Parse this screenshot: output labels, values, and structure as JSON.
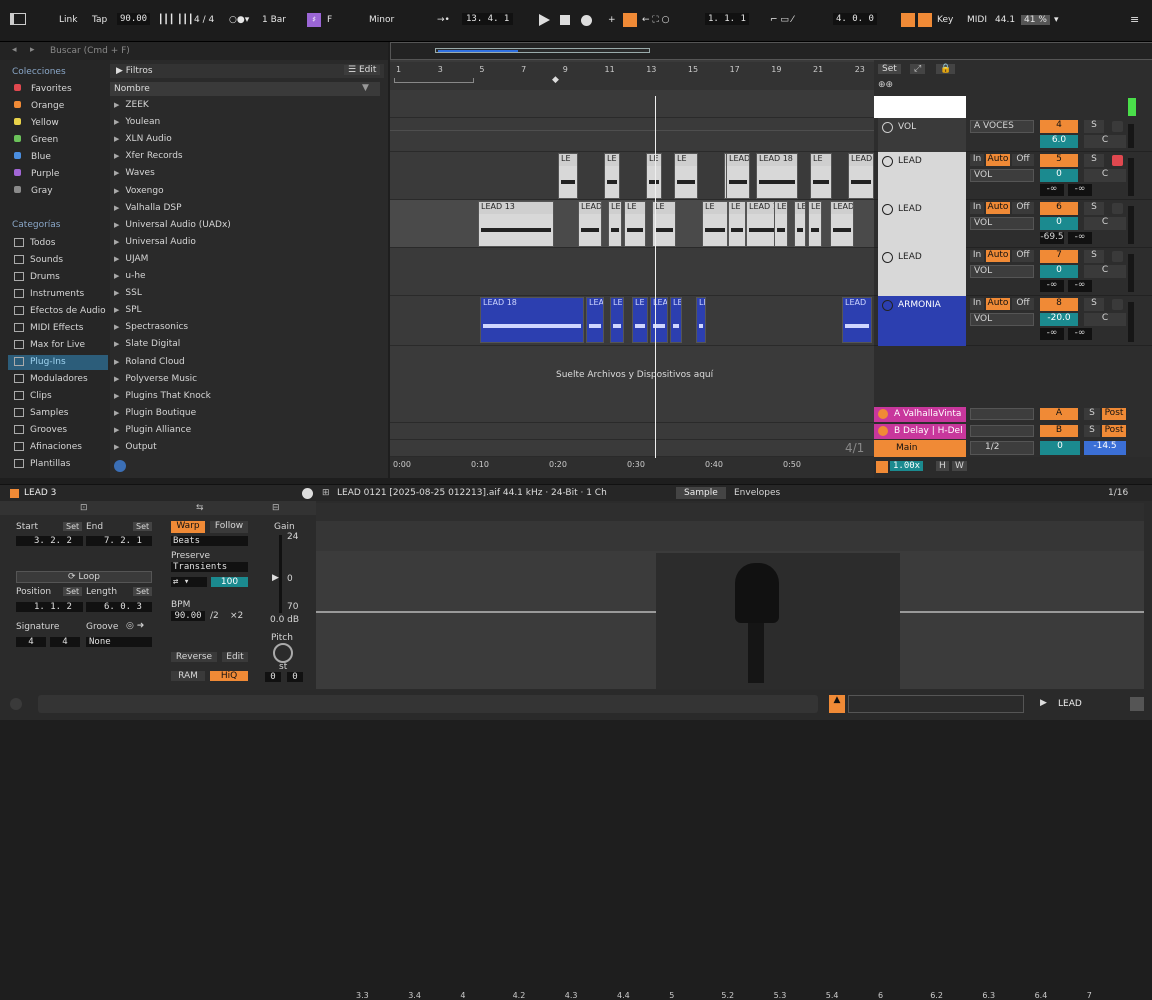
{
  "transport": {
    "link": "Link",
    "tap": "Tap",
    "tempo": "90.00",
    "meter": "4 / 4",
    "quantize": "1 Bar",
    "key_root": "F",
    "scale": "Minor",
    "position": "13.   4.   1",
    "loop_start": "1.   1.   1",
    "loop_length": "4.   0.   0",
    "key_btn": "Key",
    "midi_btn": "MIDI",
    "sample_rate": "44.1",
    "cpu": "41 %"
  },
  "browser": {
    "search_placeholder": "Buscar (Cmd + F)",
    "colecciones_title": "Colecciones",
    "colecciones": [
      {
        "label": "Favorites",
        "color": "#e0484f"
      },
      {
        "label": "Orange",
        "color": "#f08a36"
      },
      {
        "label": "Yellow",
        "color": "#e8d24a"
      },
      {
        "label": "Green",
        "color": "#6bc25a"
      },
      {
        "label": "Blue",
        "color": "#4a8ee0"
      },
      {
        "label": "Purple",
        "color": "#a266d6"
      },
      {
        "label": "Gray",
        "color": "#8a8a8a"
      }
    ],
    "categorias_title": "Categorías",
    "categorias": [
      "Todos",
      "Sounds",
      "Drums",
      "Instruments",
      "Efectos de Audio",
      "MIDI Effects",
      "Max for Live",
      "Plug-Ins",
      "Moduladores",
      "Clips",
      "Samples",
      "Grooves",
      "Afinaciones",
      "Plantillas"
    ],
    "filtros": "Filtros",
    "edit": "Edit",
    "nombre": "Nombre",
    "folders": [
      "ZEEK",
      "Youlean",
      "XLN Audio",
      "Xfer Records",
      "Waves",
      "Voxengo",
      "Valhalla DSP",
      "Universal Audio (UADx)",
      "Universal Audio",
      "UJAM",
      "u-he",
      "SSL",
      "SPL",
      "Spectrasonics",
      "Slate Digital",
      "Roland Cloud",
      "Polyverse Music",
      "Plugins That Knock",
      "Plugin Boutique",
      "Plugin Alliance",
      "Output"
    ]
  },
  "arrangement": {
    "ruler": [
      "1",
      "3",
      "5",
      "7",
      "9",
      "11",
      "13",
      "15",
      "17",
      "19",
      "21",
      "23"
    ],
    "set_btn": "Set",
    "drop_hint": "Suelte Archivos y Dispositivos aquí",
    "time_ruler": [
      "0:00",
      "0:10",
      "0:20",
      "0:30",
      "0:40",
      "0:50"
    ],
    "time_sig": "4/1",
    "clips_lead1": [
      "LE",
      "LE",
      "LE",
      "LE",
      "LEAD",
      "LEAD",
      "LEAD 18",
      "LE",
      "LEAD"
    ],
    "clips_lead2": [
      "LEAD 13",
      "LEAD",
      "LE",
      "LE",
      "LE",
      "LE",
      "LE",
      "LEAD 1",
      "LE",
      "LE",
      "LE",
      "LEAD"
    ],
    "clips_armonia": [
      "LEAD 18",
      "LEA",
      "LE",
      "LE",
      "LEAI",
      "LE",
      "LE",
      "LEAD"
    ]
  },
  "mixer": {
    "tracks": [
      {
        "name": "VOL",
        "routing": "A VOCES",
        "num": "4",
        "vol": "6.0",
        "pan": "C"
      },
      {
        "name": "LEAD",
        "routing": "VOL",
        "num": "5",
        "vol": "0",
        "pan": "C",
        "send1": "-∞",
        "send2": "-∞"
      },
      {
        "name": "LEAD",
        "routing": "VOL",
        "num": "6",
        "vol": "0",
        "pan": "C",
        "send1": "-69.5",
        "send2": "-∞"
      },
      {
        "name": "LEAD",
        "routing": "VOL",
        "num": "7",
        "vol": "0",
        "pan": "C",
        "send1": "-∞",
        "send2": "-∞"
      },
      {
        "name": "ARMONIA",
        "routing": "VOL",
        "num": "8",
        "vol": "-20.0",
        "pan": "C",
        "send1": "-∞",
        "send2": "-∞"
      }
    ],
    "returns": [
      {
        "name": "A ValhallaVinta",
        "letter": "A",
        "post": "Post"
      },
      {
        "name": "B Delay | H-Del",
        "letter": "B",
        "post": "Post"
      }
    ],
    "main": {
      "name": "Main",
      "routing": "1/2",
      "num": "0",
      "vol": "-14.5"
    },
    "in": "In",
    "auto": "Auto",
    "off": "Off",
    "s": "S",
    "c": "C",
    "zoom": "1.00x",
    "h": "H",
    "w": "W"
  },
  "clipview": {
    "title": "LEAD 3",
    "start_label": "Start",
    "end_label": "End",
    "set": "Set",
    "start_val": "3.   2.   2",
    "end_val": "7.   2.   1",
    "loop": "Loop",
    "position_label": "Position",
    "length_label": "Length",
    "position_val": "1.   1.   2",
    "length_val": "6.   0.   3",
    "signature_label": "Signature",
    "groove_label": "Groove",
    "sig_num": "4",
    "sig_den": "4",
    "groove_val": "None",
    "warp": "Warp",
    "follow": "Follow",
    "warp_mode": "Beats",
    "preserve_label": "Preserve",
    "preserve_val": "Transients",
    "transient_val": "100",
    "bpm_label": "BPM",
    "bpm_val": "90.00",
    "half": "/2",
    "double": "×2",
    "reverse": "Reverse",
    "edit": "Edit",
    "ram": "RAM",
    "hiq": "HiQ",
    "gain_label": "Gain",
    "gain_top": "24",
    "gain_zero": "0",
    "gain_bottom": "70",
    "gain_val": "0.0 dB",
    "pitch_label": "Pitch",
    "pitch_unit": "st",
    "pitch_val1": "0",
    "pitch_val2": "0"
  },
  "sampleview": {
    "file": "LEAD 0121 [2025-08-25 012213].aif  44.1 kHz · 24-Bit · 1 Ch",
    "tab_sample": "Sample",
    "tab_env": "Envelopes",
    "grid": "1/16",
    "ruler": [
      "3.3",
      "3.4",
      "4",
      "4.2",
      "4.3",
      "4.4",
      "5",
      "5.2",
      "5.3",
      "5.4",
      "6",
      "6.2",
      "6.3",
      "6.4",
      "7"
    ]
  },
  "statusbar": {
    "track_name": "LEAD"
  }
}
